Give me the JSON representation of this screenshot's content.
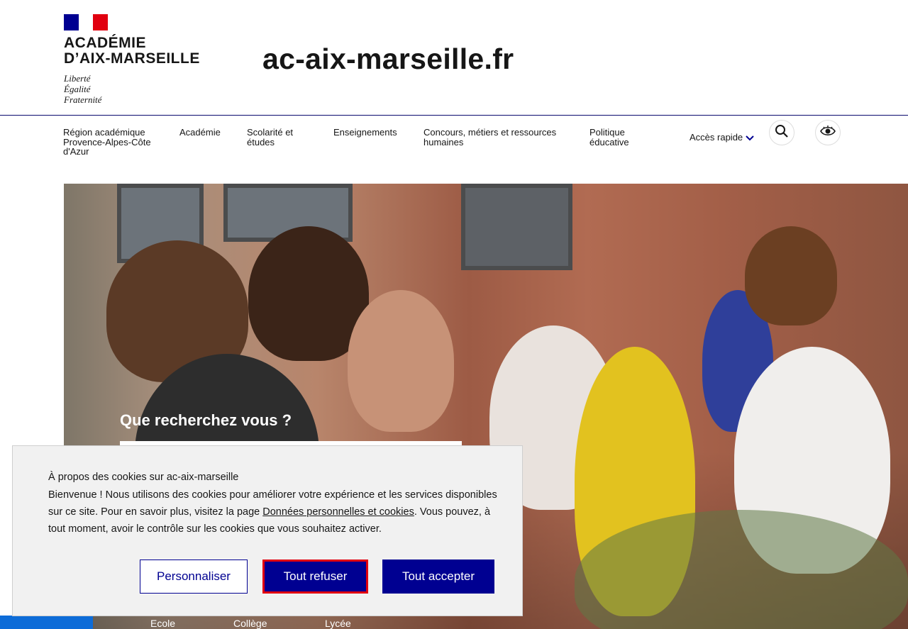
{
  "header": {
    "logo": {
      "title_line1": "ACADÉMIE",
      "title_line2": "D’AIX-MARSEILLE",
      "motto": [
        "Liberté",
        "Égalité",
        "Fraternité"
      ]
    },
    "site_name": "ac-aix-marseille.fr"
  },
  "nav": {
    "items": [
      "Région académique Provence-Alpes-Côte d'Azur",
      "Académie",
      "Scolarité et études",
      "Enseignements",
      "Concours, métiers et ressources humaines",
      "Politique éducative"
    ],
    "quick_access": "Accès rapide",
    "search_icon": "search-icon",
    "display_icon": "eye-icon"
  },
  "hero": {
    "search_title": "Que recherchez vous ?",
    "levels": [
      "Ecole",
      "Collège",
      "Lycée"
    ]
  },
  "cookie_banner": {
    "title": "À propos des cookies sur ac-aix-marseille",
    "text_before_link": "Bienvenue ! Nous utilisons des cookies pour améliorer votre expérience et les services disponibles sur ce site. Pour en savoir plus, visitez la page ",
    "link_text": "Données personnelles et cookies",
    "text_after_link": ". Vous pouvez, à tout moment, avoir le contrôle sur les cookies que vous souhaitez activer.",
    "buttons": {
      "customize": "Personnaliser",
      "refuse_all": "Tout refuser",
      "accept_all": "Tout accepter"
    }
  },
  "colors": {
    "primary_blue": "#000091",
    "marianne_red": "#e1000f",
    "text": "#161616",
    "banner_bg": "#f1f1f1"
  }
}
